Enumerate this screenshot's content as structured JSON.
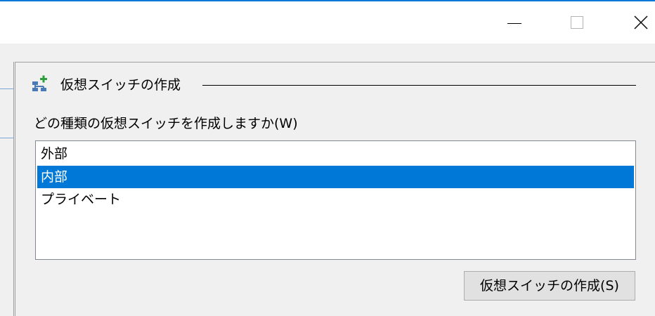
{
  "window": {
    "controls": {
      "minimize_icon": "minimize-icon",
      "maximize_icon": "maximize-icon",
      "close_icon": "close-icon"
    }
  },
  "section": {
    "icon": "network-add-icon",
    "title": "仮想スイッチの作成"
  },
  "question": "どの種類の仮想スイッチを作成しますか(W)",
  "switch_types": {
    "items": [
      "外部",
      "内部",
      "プライベート"
    ],
    "selected": "内部"
  },
  "create_button_label": "仮想スイッチの作成(S)",
  "colors": {
    "accent": "#0078d7",
    "selection_text": "#ffffff",
    "panel_bg": "#f0f0f0"
  }
}
